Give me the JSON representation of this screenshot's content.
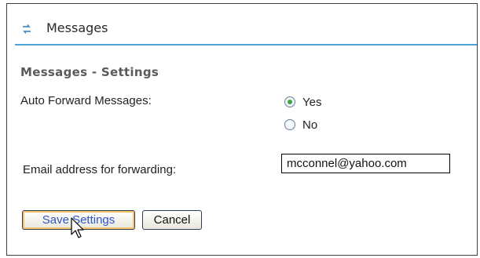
{
  "header": {
    "title": "Messages",
    "icon": "refresh-arrows-icon"
  },
  "section": {
    "title": "Messages - Settings"
  },
  "form": {
    "auto_forward_label": "Auto Forward Messages:",
    "options": [
      {
        "label": "Yes",
        "selected": true
      },
      {
        "label": "No",
        "selected": false
      }
    ],
    "email_label": "Email address for forwarding:",
    "email_value": "mcconnel@yahoo.com"
  },
  "buttons": {
    "save_label": "Save Settings",
    "cancel_label": "Cancel"
  },
  "colors": {
    "accent_rule": "#4ea6d8",
    "save_text": "#2e55c8",
    "radio_dot": "#3ea540"
  }
}
